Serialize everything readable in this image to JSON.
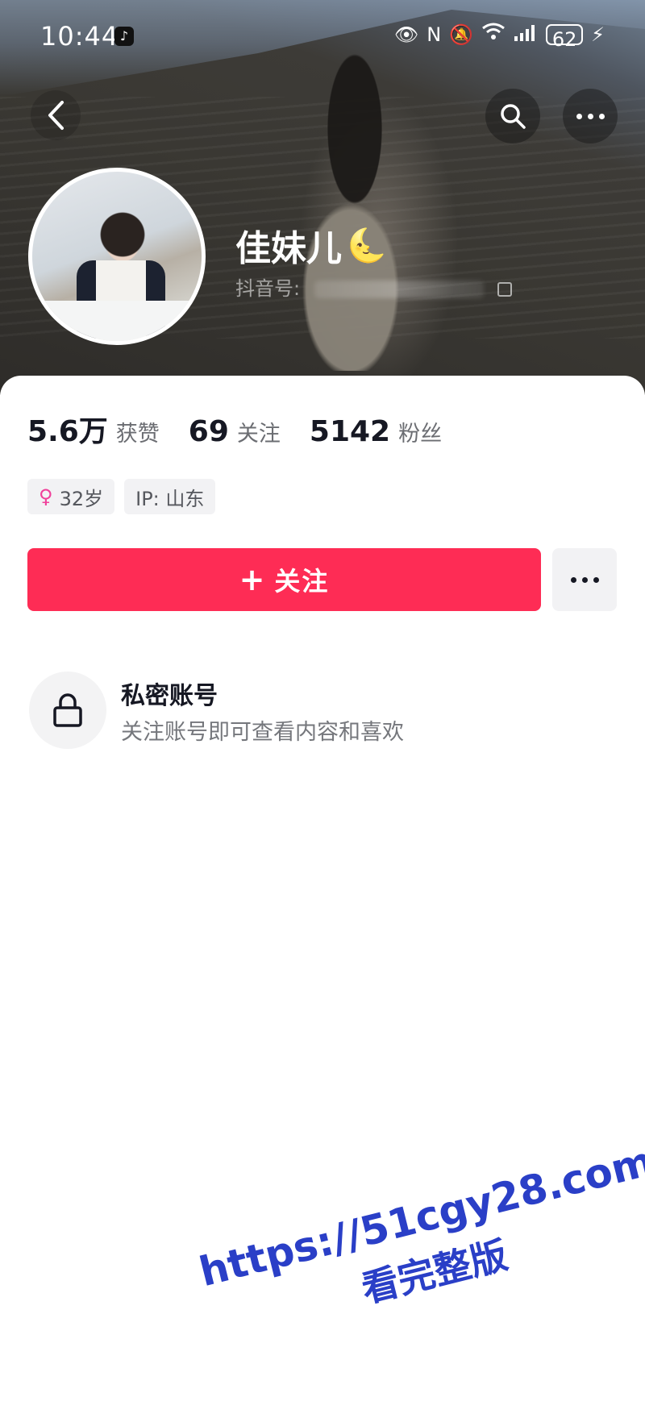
{
  "status_bar": {
    "time": "10:44",
    "battery": "62"
  },
  "profile": {
    "name": "佳妹儿",
    "id_label": "抖音号:"
  },
  "stats": [
    {
      "value": "5.6万",
      "label": "获赞"
    },
    {
      "value": "69",
      "label": "关注"
    },
    {
      "value": "5142",
      "label": "粉丝"
    }
  ],
  "tags": {
    "age": "32岁",
    "ip": "IP:  山东"
  },
  "actions": {
    "follow_label": "关注"
  },
  "private": {
    "title": "私密账号",
    "description": "关注账号即可查看内容和喜欢"
  },
  "watermark": {
    "url": "https://51cgy28.com",
    "text": "看完整版"
  },
  "colors": {
    "follow_button": "#fe2c55",
    "watermark": "#2a3fc7"
  }
}
